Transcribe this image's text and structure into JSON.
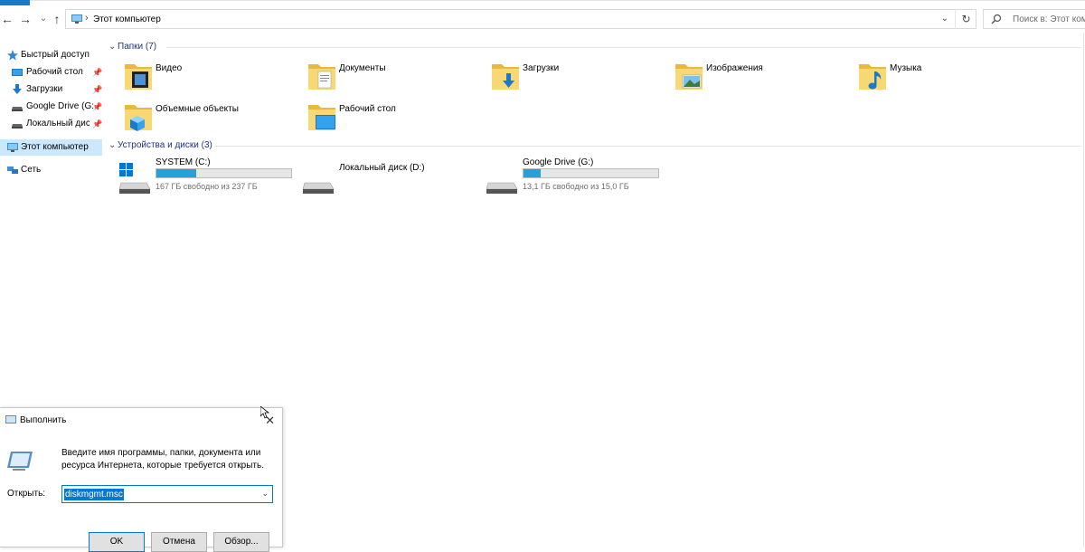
{
  "address": {
    "crumb": "Этот компьютер",
    "search_placeholder": "Поиск в: Этот комп..."
  },
  "sidebar": {
    "items": [
      {
        "label": "Быстрый доступ"
      },
      {
        "label": "Рабочий стол"
      },
      {
        "label": "Загрузки"
      },
      {
        "label": "Google Drive (G:"
      },
      {
        "label": "Локальный диск"
      },
      {
        "label": "Этот компьютер"
      },
      {
        "label": "Сеть"
      }
    ]
  },
  "folders": {
    "header": "Папки (7)",
    "items": [
      {
        "label": "Видео"
      },
      {
        "label": "Документы"
      },
      {
        "label": "Загрузки"
      },
      {
        "label": "Изображения"
      },
      {
        "label": "Музыка"
      },
      {
        "label": "Объемные объекты"
      },
      {
        "label": "Рабочий стол"
      }
    ]
  },
  "drives": {
    "header": "Устройства и диски (3)",
    "items": [
      {
        "name": "SYSTEM (C:)",
        "free": "167 ГБ свободно из 237 ГБ",
        "used_fraction": 0.295
      },
      {
        "name": "Локальный диск (D:)",
        "free": "",
        "used_fraction": null
      },
      {
        "name": "Google Drive (G:)",
        "free": "13,1 ГБ свободно из 15,0 ГБ",
        "used_fraction": 0.127
      }
    ]
  },
  "run_dialog": {
    "title": "Выполнить",
    "description": "Введите имя программы, папки, документа или ресурса Интернета, которые требуется открыть.",
    "open_label": "Открыть:",
    "input_value": "diskmgmt.msc",
    "ok": "OK",
    "cancel": "Отмена",
    "browse": "Обзор..."
  },
  "colors": {
    "accent": "#0078d7",
    "drive_bar": "#26a0da",
    "group_header": "#1e3287",
    "selected_bg": "#cce8ff"
  }
}
